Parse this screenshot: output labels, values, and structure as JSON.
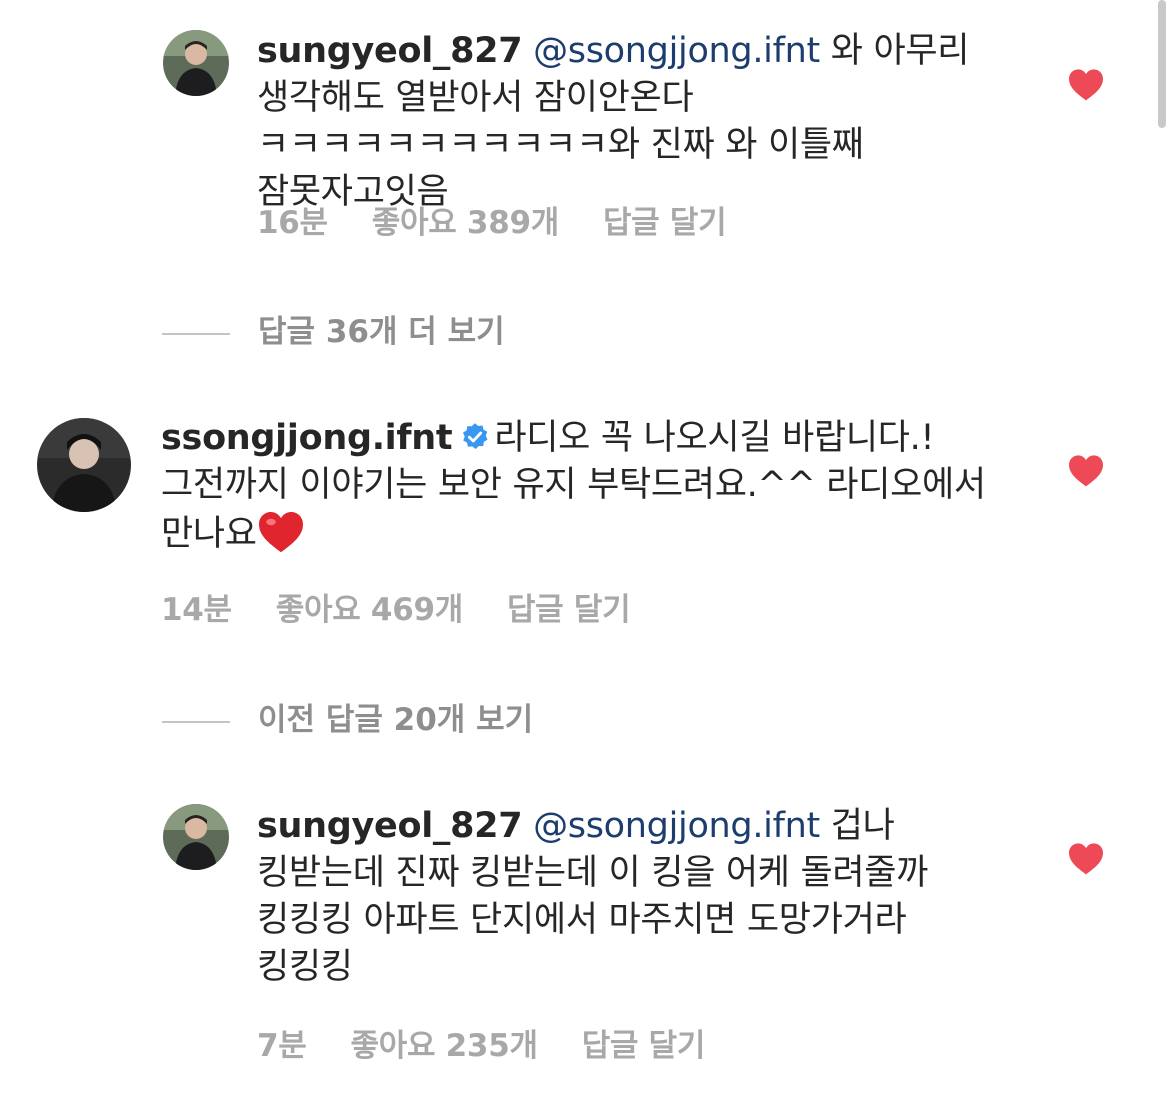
{
  "colors": {
    "like": "#ed4956",
    "mention": "#1c3d6e",
    "meta": "#a8a8a8",
    "verified": "#3897f0"
  },
  "comments": [
    {
      "username": "sungyeol_827",
      "mention": "@ssongjjong.ifnt",
      "body": " 와 아무리 생각해도 열받아서 잠이안온다 ㅋㅋㅋㅋㅋㅋㅋㅋㅋㅋㅋ와 진짜 와 이틀째 잠못자고잇음",
      "time": "16분",
      "likes": "좋아요 389개",
      "reply": "답글 달기"
    },
    {
      "username": "ssongjjong.ifnt",
      "verified": true,
      "body": "라디오 꼭 나오시길 바랍니다.!그전까지 이야기는 보안 유지 부탁드려요.^^ 라디오에서 만나요",
      "time": "14분",
      "likes": "좋아요 469개",
      "reply": "답글 달기"
    },
    {
      "username": "sungyeol_827",
      "mention": "@ssongjjong.ifnt",
      "body": " 겁나 킹받는데 진짜 킹받는데 이 킹을 어케 돌려줄까 킹킹킹 아파트 단지에서 마주치면 도망가거라 킹킹킹",
      "time": "7분",
      "likes": "좋아요 235개",
      "reply": "답글 달기"
    }
  ],
  "view_more_1": "답글 36개 더 보기",
  "view_more_2": "이전 답글 20개 보기",
  "icons": {
    "like": "heart-filled-icon",
    "verified": "verified-badge-icon",
    "emoji": "red-heart-emoji"
  }
}
